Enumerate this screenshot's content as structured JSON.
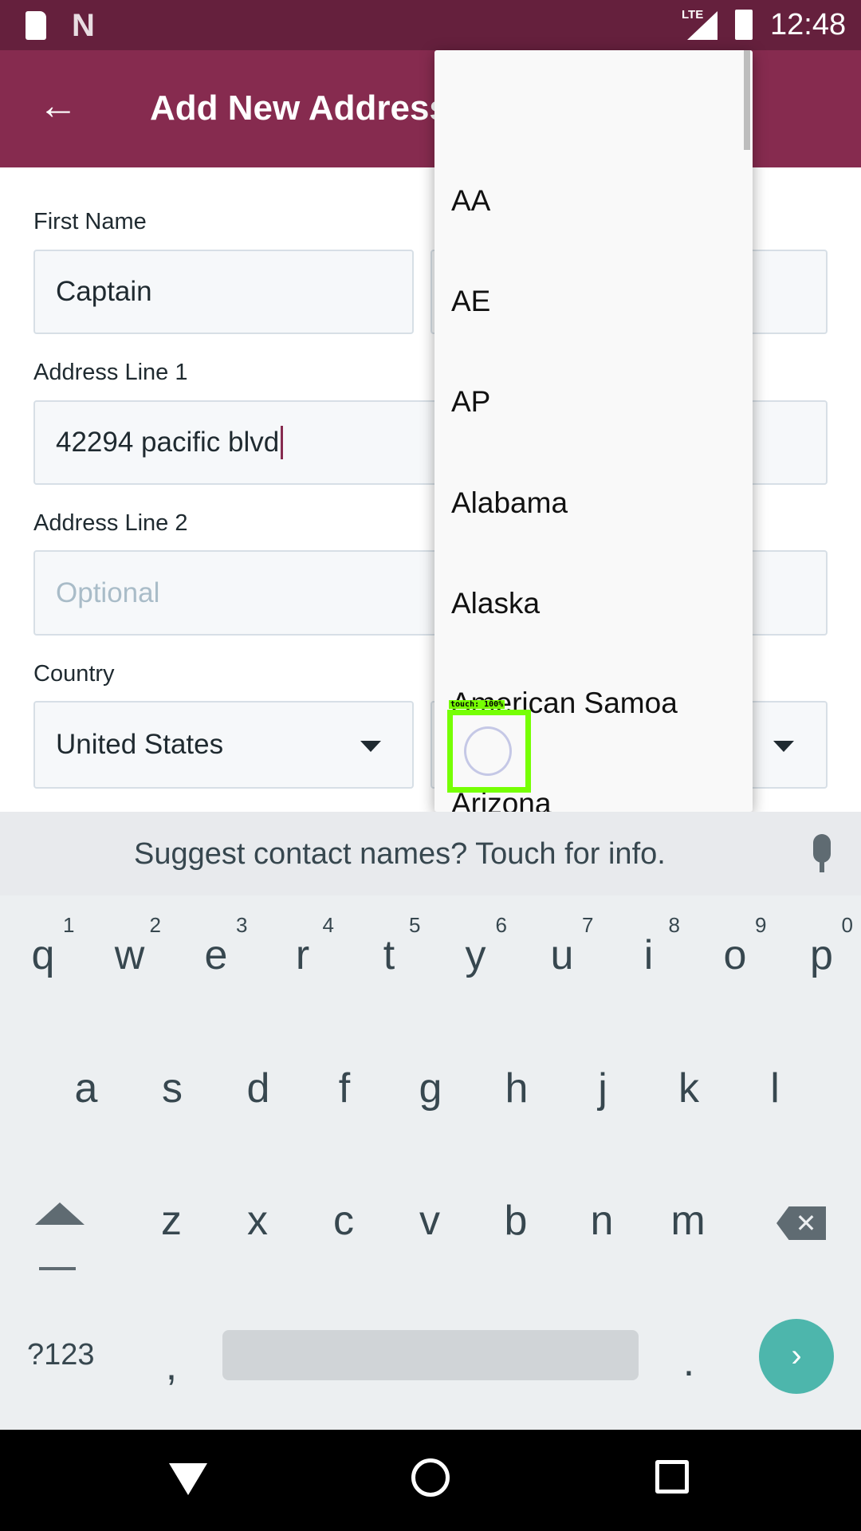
{
  "status": {
    "time": "12:48",
    "network": "LTE"
  },
  "header": {
    "title": "Add New Address"
  },
  "form": {
    "first_name_label": "First Name",
    "first_name": "Captain",
    "address1_label": "Address Line 1",
    "address1": "42294 pacific blvd",
    "address2_label": "Address Line 2",
    "address2_placeholder": "Optional",
    "country_label": "Country",
    "country": "United States"
  },
  "dropdown": {
    "options": [
      "AA",
      "AE",
      "AP",
      "Alabama",
      "Alaska",
      "American Samoa",
      "Arizona"
    ]
  },
  "touch_overlay": "touch: 100%",
  "keyboard": {
    "suggestion": "Suggest contact names? Touch for info.",
    "row1": [
      "q",
      "w",
      "e",
      "r",
      "t",
      "y",
      "u",
      "i",
      "o",
      "p"
    ],
    "row1_hints": [
      "1",
      "2",
      "3",
      "4",
      "5",
      "6",
      "7",
      "8",
      "9",
      "0"
    ],
    "row2": [
      "a",
      "s",
      "d",
      "f",
      "g",
      "h",
      "j",
      "k",
      "l"
    ],
    "row3": [
      "z",
      "x",
      "c",
      "v",
      "b",
      "n",
      "m"
    ],
    "symbols": "?123",
    "comma": ",",
    "period": "."
  },
  "colors": {
    "status": "#65203d",
    "appbar": "#862b4f",
    "enter": "#4db6ac"
  }
}
